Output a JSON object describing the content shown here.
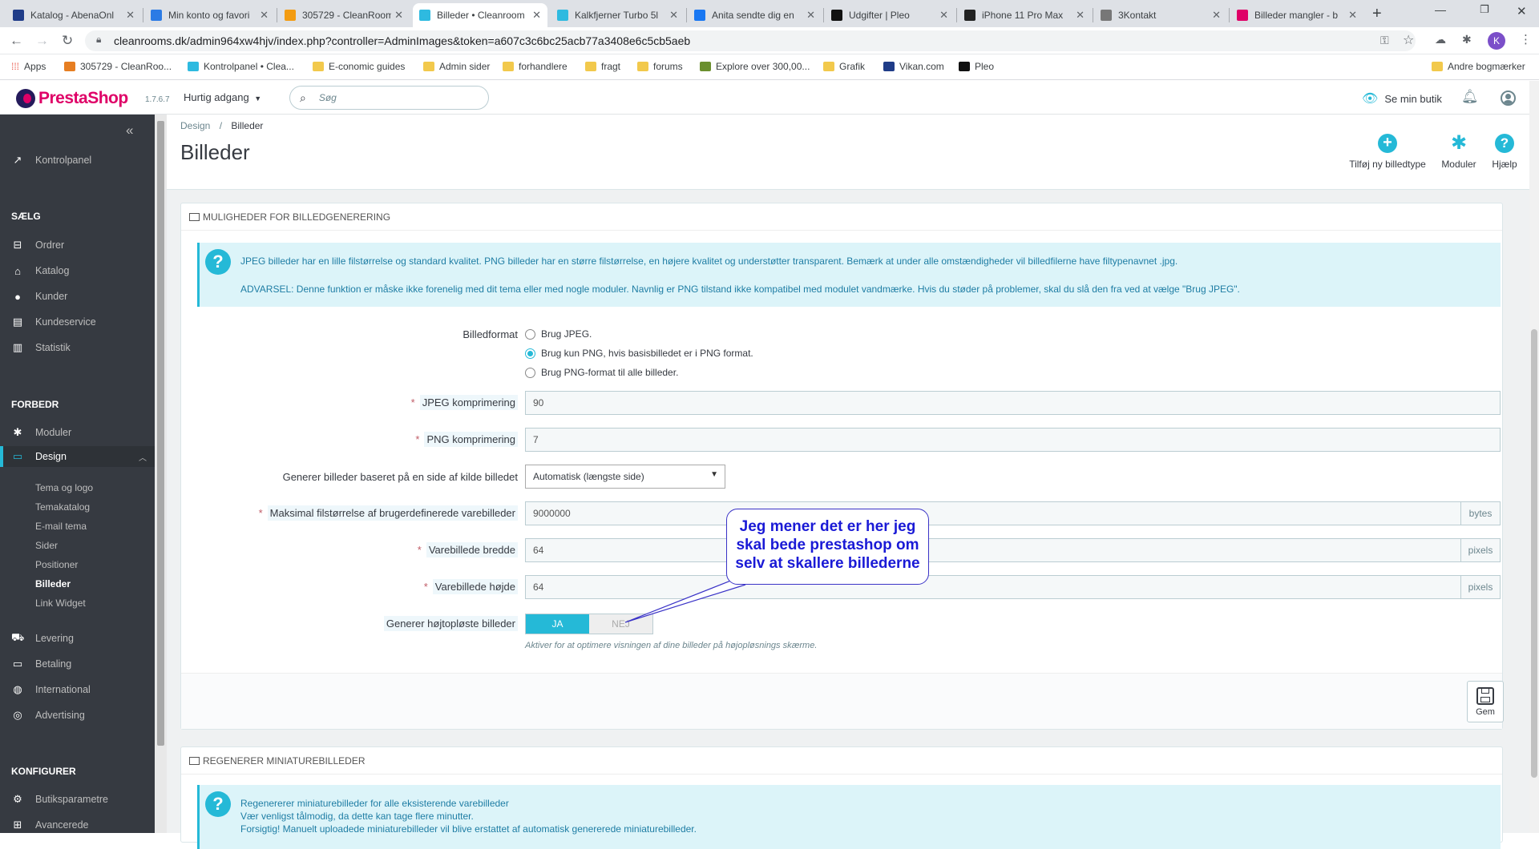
{
  "browser": {
    "tabs": [
      {
        "title": "Katalog - AbenaOnl",
        "fav": "#1f3c88"
      },
      {
        "title": "Min konto og favori",
        "fav": "#2c7be5"
      },
      {
        "title": "305729 - CleanRoom",
        "fav": "#f39c12"
      },
      {
        "title": "Billeder • Cleanroom",
        "fav": "#2ebae0",
        "active": true
      },
      {
        "title": "Kalkfjerner Turbo 5l",
        "fav": "#2ebae0"
      },
      {
        "title": "Anita sendte dig en",
        "fav": "#1877f2"
      },
      {
        "title": "Udgifter | Pleo",
        "fav": "#111111"
      },
      {
        "title": "iPhone 11 Pro Max",
        "fav": "#222222"
      },
      {
        "title": "3Kontakt",
        "fav": "#777777"
      },
      {
        "title": "Billeder mangler - b",
        "fav": "#df0067"
      }
    ],
    "url": "cleanrooms.dk/admin964xw4hjv/index.php?controller=AdminImages&token=a607c3c6bc25acb77a3408e6c5cb5aeb",
    "profile_initial": "K",
    "bookmarks": [
      {
        "label": "Apps",
        "kind": "apps"
      },
      {
        "label": "305729 - CleanRoo...",
        "kind": "site"
      },
      {
        "label": "Kontrolpanel • Clea...",
        "kind": "site"
      },
      {
        "label": "E-conomic guides",
        "kind": "folder"
      },
      {
        "label": "Admin sider",
        "kind": "folder"
      },
      {
        "label": "forhandlere",
        "kind": "folder"
      },
      {
        "label": "fragt",
        "kind": "folder"
      },
      {
        "label": "forums",
        "kind": "folder"
      },
      {
        "label": "Explore over 300,00...",
        "kind": "site"
      },
      {
        "label": "Grafik",
        "kind": "folder"
      },
      {
        "label": "Vikan.com",
        "kind": "site"
      },
      {
        "label": "Pleo",
        "kind": "site"
      }
    ],
    "other_bookmarks": "Andre bogmærker"
  },
  "header": {
    "logo": "PrestaShop",
    "version": "1.7.6.7",
    "quick_access": "Hurtig adgang",
    "search_placeholder": "Søg",
    "view_shop": "Se min butik"
  },
  "sidebar": {
    "dashboard": "Kontrolpanel",
    "sell_title": "SÆLG",
    "sell_items": [
      "Ordrer",
      "Katalog",
      "Kunder",
      "Kundeservice",
      "Statistik"
    ],
    "improve_title": "FORBEDR",
    "modules": "Moduler",
    "design": "Design",
    "design_sub": [
      "Tema og logo",
      "Temakatalog",
      "E-mail tema",
      "Sider",
      "Positioner",
      "Billeder",
      "Link Widget"
    ],
    "more_items": [
      "Levering",
      "Betaling",
      "International",
      "Advertising"
    ],
    "configure_title": "KONFIGURER",
    "configure_items": [
      "Butiksparametre",
      "Avancerede"
    ]
  },
  "page": {
    "breadcrumb_parent": "Design",
    "breadcrumb_current": "Billeder",
    "title": "Billeder",
    "toolbar": {
      "add": "Tilføj ny billedtype",
      "modules": "Moduler",
      "help": "Hjælp"
    }
  },
  "panel1": {
    "heading": "MULIGHEDER FOR BILLEDGENERERING",
    "info1": "JPEG billeder har en lille filstørrelse og standard kvalitet. PNG billeder har en større filstørrelse, en højere kvalitet og understøtter transparent. Bemærk at under alle omstændigheder vil billedfilerne have filtypenavnet .jpg.",
    "info2": "ADVARSEL: Denne funktion er måske ikke forenelig med dit tema eller med nogle moduler. Navnlig er PNG tilstand ikke kompatibel med modulet vandmærke. Hvis du støder på problemer, skal du slå den fra ved at vælge \"Brug JPEG\".",
    "format_label": "Billedformat",
    "format_options": [
      "Brug JPEG.",
      "Brug kun PNG, hvis basisbilledet er i PNG format.",
      "Brug PNG-format til alle billeder."
    ],
    "format_selected": 1,
    "jpeg_label": "JPEG komprimering",
    "jpeg_value": "90",
    "png_label": "PNG komprimering",
    "png_value": "7",
    "side_label": "Generer billeder baseret på en side af kilde billedet",
    "side_value": "Automatisk (længste side)",
    "maxsize_label": "Maksimal filstørrelse af brugerdefinerede varebilleder",
    "maxsize_value": "9000000",
    "maxsize_unit": "bytes",
    "width_label": "Varebillede bredde",
    "width_value": "64",
    "width_unit": "pixels",
    "height_label": "Varebillede højde",
    "height_value": "64",
    "height_unit": "pixels",
    "hires_label": "Generer højtopløste billeder",
    "hires_yes": "JA",
    "hires_no": "NEJ",
    "hires_help": "Aktiver for at optimere visningen af dine billeder på højopløsnings skærme.",
    "save": "Gem"
  },
  "annotation": "Jeg mener det er her jeg skal bede prestashop om selv at skallere billederne",
  "panel2": {
    "heading": "REGENERER MINIATUREBILLEDER",
    "info_line1": "Regenererer miniaturebilleder for alle eksisterende varebilleder",
    "info_line2": "Vær venligst tålmodig, da dette kan tage flere minutter.",
    "info_line3": "Forsigtig! Manuelt uploadede miniaturebilleder vil blive erstattet af automatisk genererede miniaturebilleder."
  }
}
